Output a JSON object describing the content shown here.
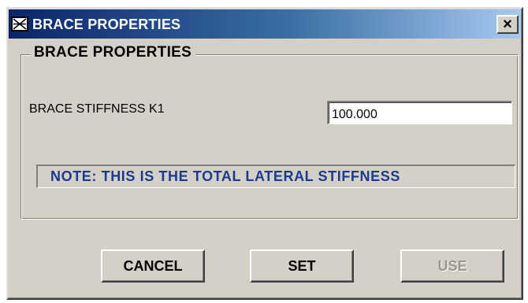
{
  "window": {
    "title": "BRACE PROPERTIES",
    "app_icon": "grid-frame-icon",
    "close_label": "×"
  },
  "group": {
    "legend": "BRACE PROPERTIES"
  },
  "stiffness": {
    "label": "BRACE STIFFNESS K1",
    "value": "100.000"
  },
  "note": {
    "text": "NOTE: THIS IS THE TOTAL LATERAL STIFFNESS",
    "color": "#1c3b8f"
  },
  "buttons": {
    "cancel": "CANCEL",
    "set": "SET",
    "use": "USE",
    "use_enabled": false
  },
  "colors": {
    "titlebar_start": "#0a246a",
    "titlebar_end": "#a6caf0",
    "face": "#d4d0c8"
  }
}
